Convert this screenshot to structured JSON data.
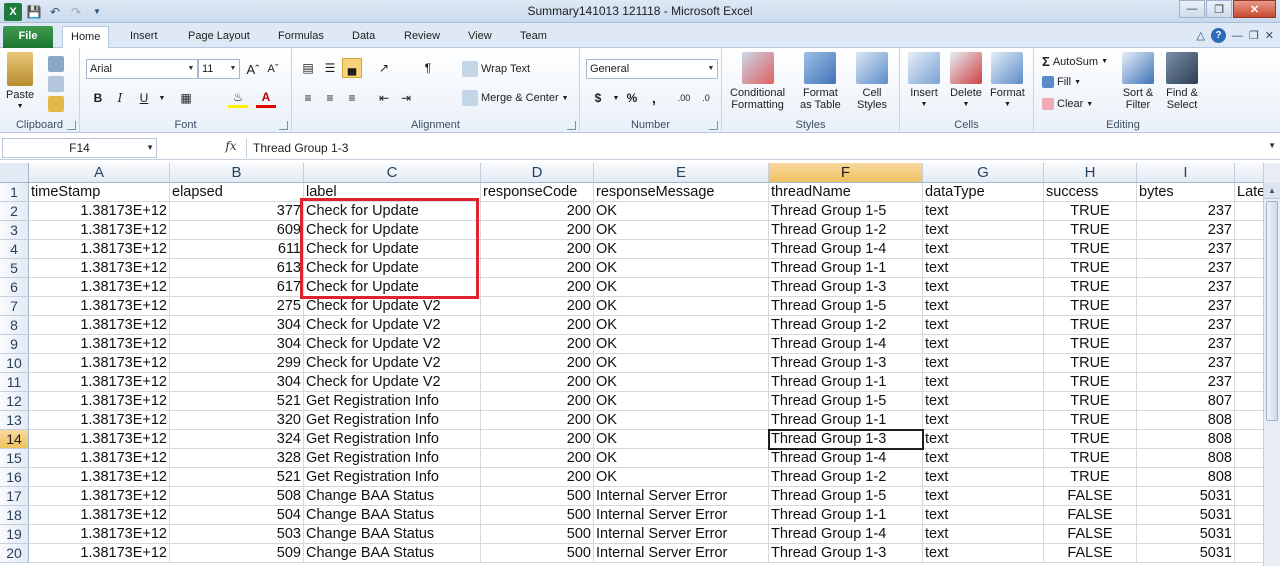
{
  "window": {
    "title": "Summary141013 121118  -  Microsoft Excel"
  },
  "tabs": [
    "File",
    "Home",
    "Insert",
    "Page Layout",
    "Formulas",
    "Data",
    "Review",
    "View",
    "Team"
  ],
  "ribbon": {
    "clipboard": {
      "label": "Clipboard",
      "paste": "Paste"
    },
    "font": {
      "label": "Font",
      "name": "Arial",
      "size": "11",
      "bold": "B",
      "italic": "I",
      "underline": "U"
    },
    "alignment": {
      "label": "Alignment",
      "wrap_text": "Wrap Text",
      "merge_center": "Merge & Center"
    },
    "number": {
      "label": "Number",
      "format": "General",
      "currency": "$",
      "percent": "%"
    },
    "styles": {
      "label": "Styles",
      "conditional": [
        "Conditional",
        "Formatting"
      ],
      "format_table": [
        "Format",
        "as Table"
      ],
      "cell_styles": [
        "Cell",
        "Styles"
      ]
    },
    "cells": {
      "label": "Cells",
      "insert": "Insert",
      "delete": "Delete",
      "format": "Format"
    },
    "editing": {
      "label": "Editing",
      "autosum": "AutoSum",
      "fill": "Fill",
      "clear": "Clear",
      "sort_filter": [
        "Sort &",
        "Filter"
      ],
      "find_select": [
        "Find &",
        "Select"
      ]
    }
  },
  "formula_bar": {
    "name_box": "F14",
    "fx": "fx",
    "formula": "Thread Group 1-3"
  },
  "grid": {
    "columns": [
      "A",
      "B",
      "C",
      "D",
      "E",
      "F",
      "G",
      "H",
      "I"
    ],
    "selected_column": "F",
    "selected_row": "14",
    "header_row": [
      "timeStamp",
      "elapsed",
      "label",
      "responseCode",
      "responseMessage",
      "threadName",
      "dataType",
      "success",
      "bytes",
      "Late"
    ],
    "rows": [
      [
        "1.38173E+12",
        "377",
        "Check for Update",
        "200",
        "OK",
        "Thread Group 1-5",
        "text",
        "TRUE",
        "237"
      ],
      [
        "1.38173E+12",
        "609",
        "Check for Update",
        "200",
        "OK",
        "Thread Group 1-2",
        "text",
        "TRUE",
        "237"
      ],
      [
        "1.38173E+12",
        "611",
        "Check for Update",
        "200",
        "OK",
        "Thread Group 1-4",
        "text",
        "TRUE",
        "237"
      ],
      [
        "1.38173E+12",
        "613",
        "Check for Update",
        "200",
        "OK",
        "Thread Group 1-1",
        "text",
        "TRUE",
        "237"
      ],
      [
        "1.38173E+12",
        "617",
        "Check for Update",
        "200",
        "OK",
        "Thread Group 1-3",
        "text",
        "TRUE",
        "237"
      ],
      [
        "1.38173E+12",
        "275",
        "Check for Update V2",
        "200",
        "OK",
        "Thread Group 1-5",
        "text",
        "TRUE",
        "237"
      ],
      [
        "1.38173E+12",
        "304",
        "Check for Update V2",
        "200",
        "OK",
        "Thread Group 1-2",
        "text",
        "TRUE",
        "237"
      ],
      [
        "1.38173E+12",
        "304",
        "Check for Update V2",
        "200",
        "OK",
        "Thread Group 1-4",
        "text",
        "TRUE",
        "237"
      ],
      [
        "1.38173E+12",
        "299",
        "Check for Update V2",
        "200",
        "OK",
        "Thread Group 1-3",
        "text",
        "TRUE",
        "237"
      ],
      [
        "1.38173E+12",
        "304",
        "Check for Update V2",
        "200",
        "OK",
        "Thread Group 1-1",
        "text",
        "TRUE",
        "237"
      ],
      [
        "1.38173E+12",
        "521",
        "Get Registration Info",
        "200",
        "OK",
        "Thread Group 1-5",
        "text",
        "TRUE",
        "807"
      ],
      [
        "1.38173E+12",
        "320",
        "Get Registration Info",
        "200",
        "OK",
        "Thread Group 1-1",
        "text",
        "TRUE",
        "808"
      ],
      [
        "1.38173E+12",
        "324",
        "Get Registration Info",
        "200",
        "OK",
        "Thread Group 1-3",
        "text",
        "TRUE",
        "808"
      ],
      [
        "1.38173E+12",
        "328",
        "Get Registration Info",
        "200",
        "OK",
        "Thread Group 1-4",
        "text",
        "TRUE",
        "808"
      ],
      [
        "1.38173E+12",
        "521",
        "Get Registration Info",
        "200",
        "OK",
        "Thread Group 1-2",
        "text",
        "TRUE",
        "808"
      ],
      [
        "1.38173E+12",
        "508",
        "Change BAA Status",
        "500",
        "Internal Server Error",
        "Thread Group 1-5",
        "text",
        "FALSE",
        "5031"
      ],
      [
        "1.38173E+12",
        "504",
        "Change BAA Status",
        "500",
        "Internal Server Error",
        "Thread Group 1-1",
        "text",
        "FALSE",
        "5031"
      ],
      [
        "1.38173E+12",
        "503",
        "Change BAA Status",
        "500",
        "Internal Server Error",
        "Thread Group 1-4",
        "text",
        "FALSE",
        "5031"
      ],
      [
        "1.38173E+12",
        "509",
        "Change BAA Status",
        "500",
        "Internal Server Error",
        "Thread Group 1-3",
        "text",
        "FALSE",
        "5031"
      ]
    ]
  },
  "colors": {
    "highlight_box": "#e0222e",
    "file_tab": "#1d7630",
    "selected_header": "#f1c15f"
  }
}
